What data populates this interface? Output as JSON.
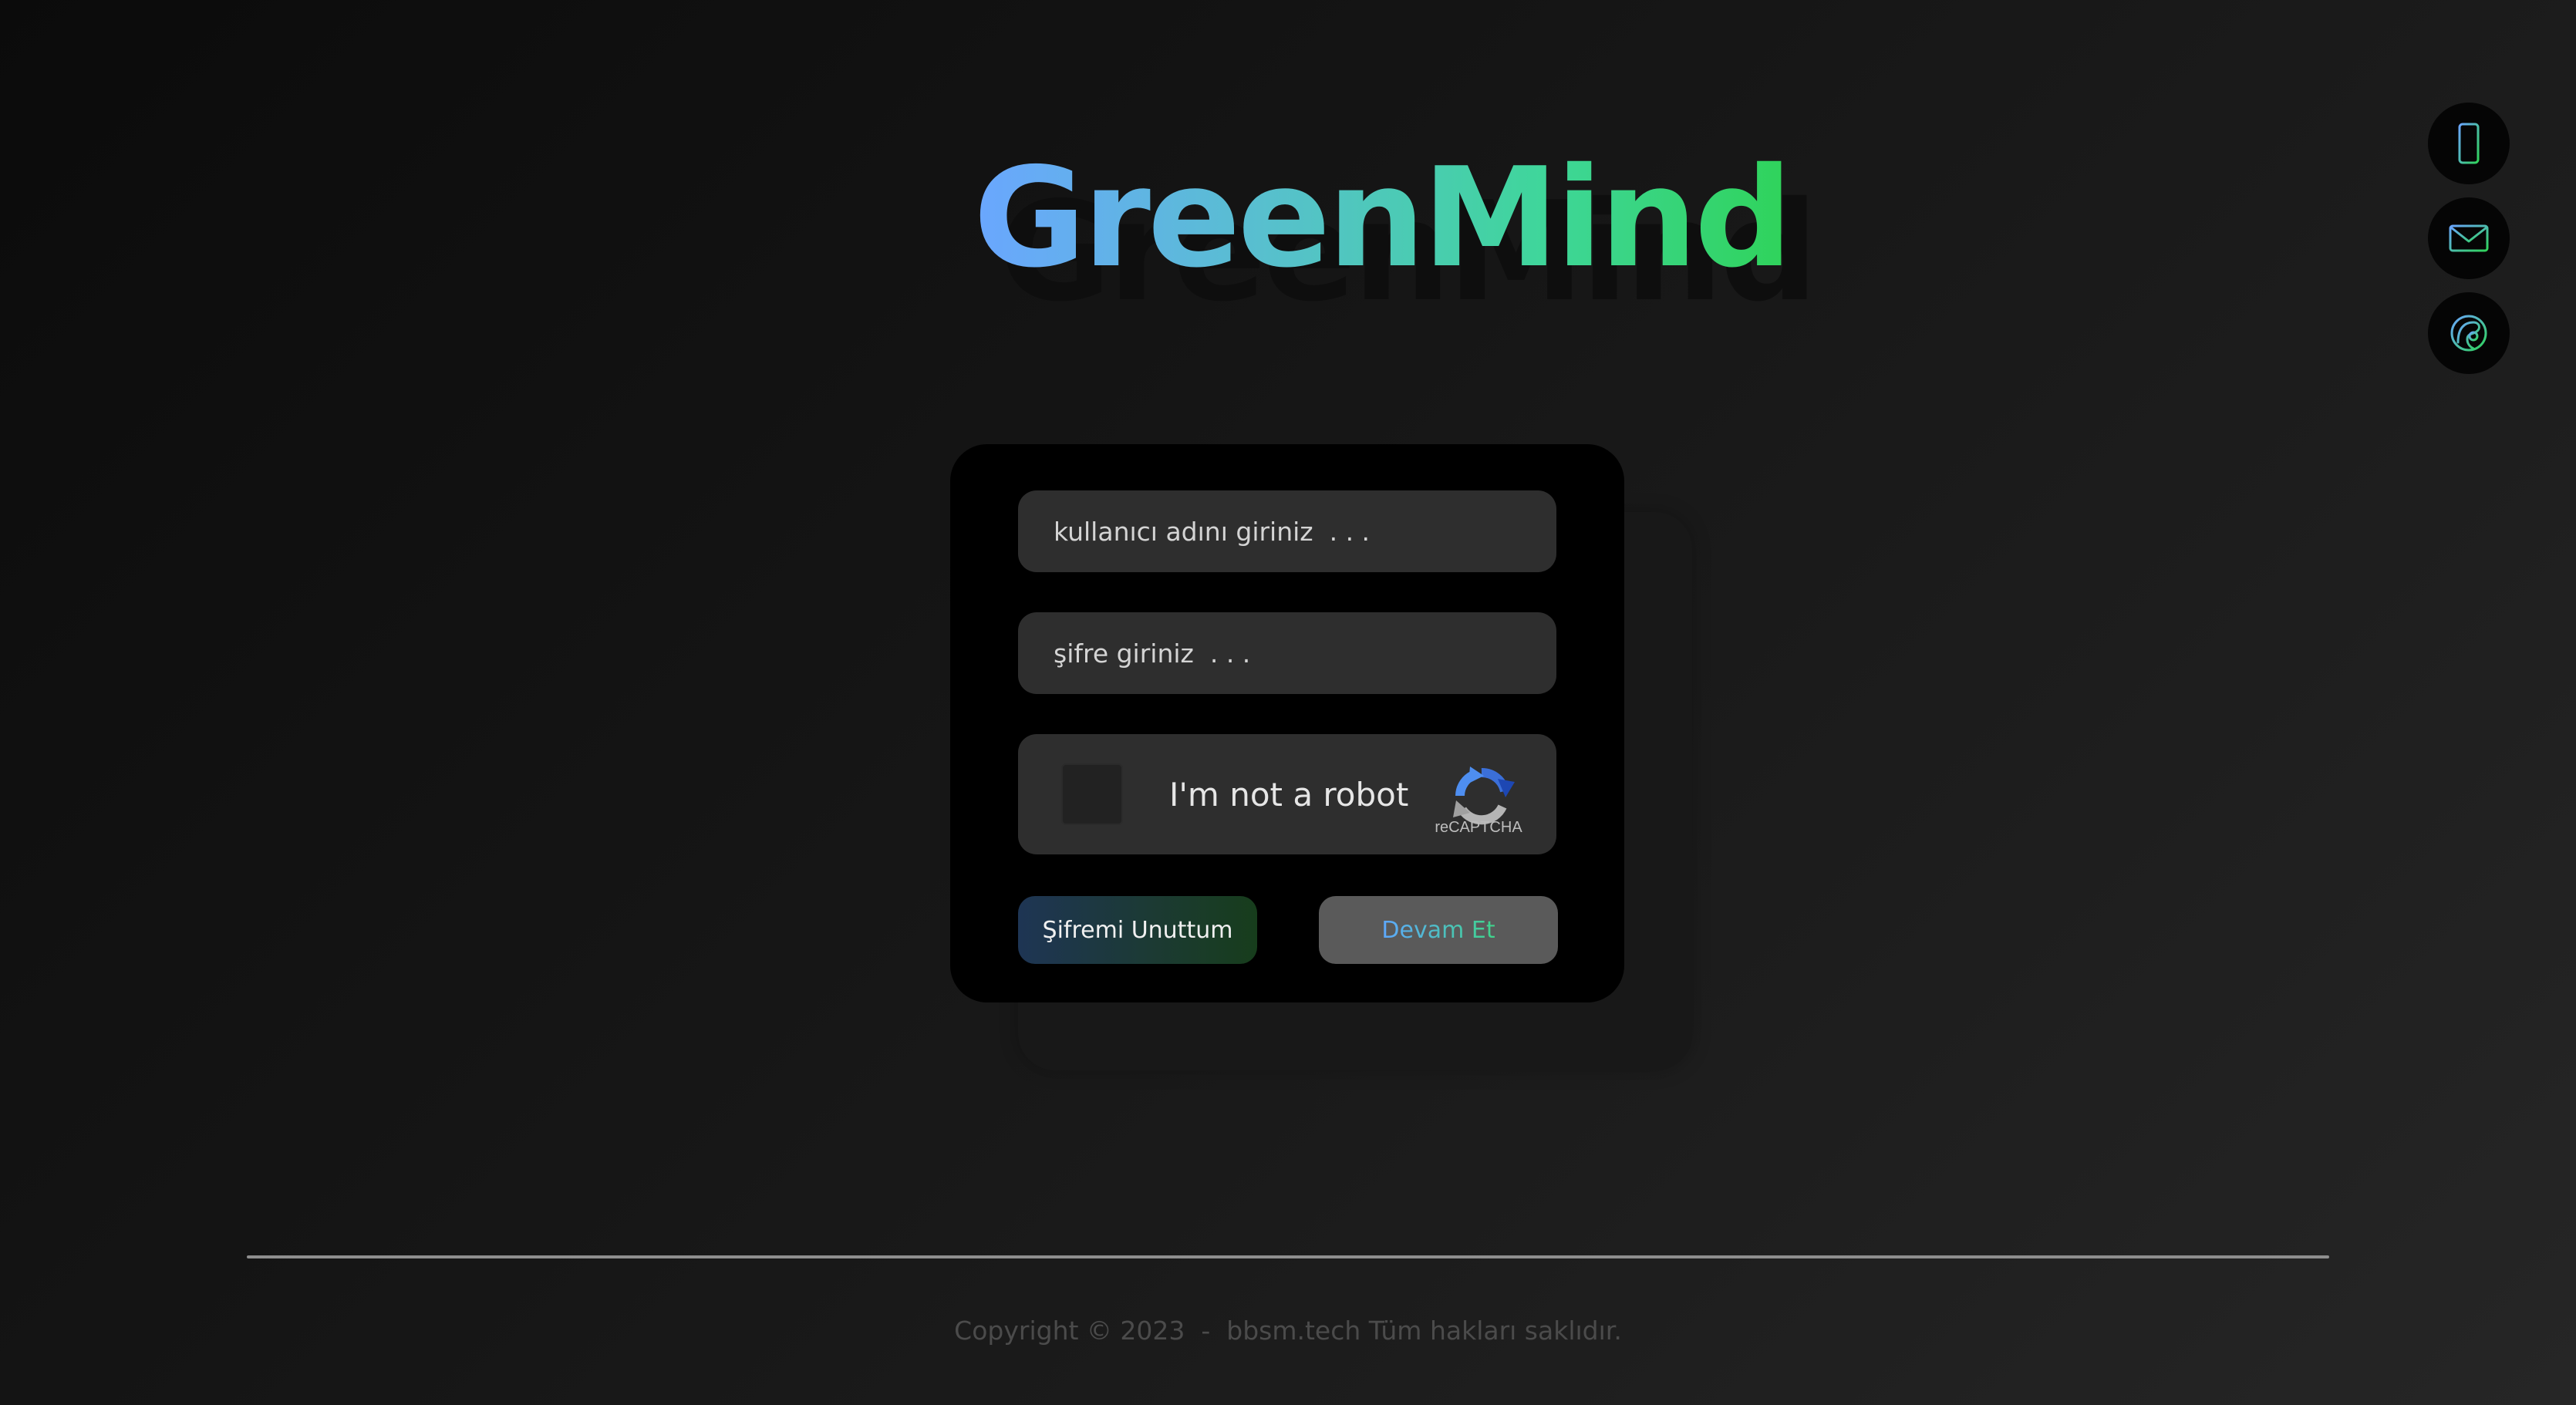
{
  "brand": {
    "logo_text": "GreenMind"
  },
  "side_icons": [
    {
      "name": "phone-icon"
    },
    {
      "name": "mail-icon"
    },
    {
      "name": "location-icon"
    }
  ],
  "login": {
    "username_placeholder": "kullanıcı adını giriniz  . . .",
    "password_placeholder": "şifre giriniz  . . .",
    "captcha_label": "I'm not a robot",
    "captcha_brand": "reCAPTCHA",
    "forgot_label": "Şifremi Unuttum",
    "continue_label": "Devam Et"
  },
  "footer": {
    "copyright": "Copyright © 2023  -  bbsm.tech Tüm hakları saklıdır."
  },
  "colors": {
    "gradient_start": "#6aa6ff",
    "gradient_end": "#2fd35a",
    "card_bg": "#000000",
    "field_bg": "#2e2e2e"
  }
}
